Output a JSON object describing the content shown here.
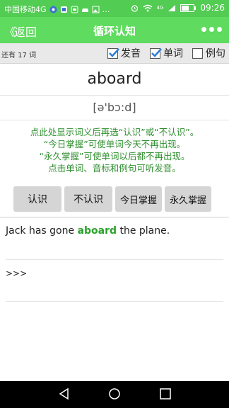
{
  "status_bar": {
    "carrier": "中国移动4G",
    "time": "09:26",
    "network": "4G"
  },
  "app_bar": {
    "back_chevron": "《",
    "back_label": "返回",
    "title": "循环认知",
    "more_icon": "more-dots-icon"
  },
  "options": {
    "remaining": "还有 17 词",
    "items": [
      {
        "label": "发音",
        "checked": true
      },
      {
        "label": "单词",
        "checked": true
      },
      {
        "label": "例句",
        "checked": false
      }
    ]
  },
  "word": "aboard",
  "phonetic": "[ə'bɔ:d]",
  "hint_lines": [
    "点此处显示词义后再选“认识”或“不认识”。",
    "“今日掌握”可使单词今天不再出现。",
    "“永久掌握”可使单词以后都不再出现。",
    "点击单词、音标和例句可听发音。"
  ],
  "actions": {
    "know": "认识",
    "dont_know": "不认识",
    "master_today": "今日掌握",
    "master_forever": "永久掌握"
  },
  "sentence": {
    "before": "Jack has gone ",
    "highlight": "aboard",
    "after": " the plane."
  },
  "more_label": ">>>",
  "colors": {
    "status_bar": "#52cc52",
    "app_bar": "#5fdb5f",
    "hint_text": "#2f8f2f",
    "highlight": "#2aa22a",
    "button_bg": "#d5d5d5"
  }
}
